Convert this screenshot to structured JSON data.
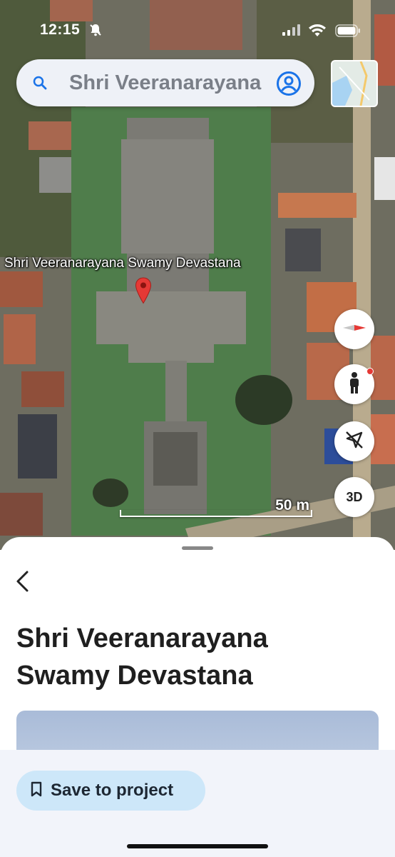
{
  "status_bar": {
    "time": "12:15"
  },
  "search": {
    "query": "Shri Veeranarayana Swamy Devastana"
  },
  "map": {
    "place_label": "Shri Veeranarayana Swamy Devastana",
    "scale_label": "50 m",
    "controls": {
      "three_d_label": "3D"
    }
  },
  "sheet": {
    "title_line1": "Shri Veeranarayana",
    "title_line2": "Swamy Devastana",
    "save_button_label": "Save to project"
  },
  "colors": {
    "accent": "#1a73e8",
    "pin": "#e53935",
    "save_button_bg": "#cde7f9"
  },
  "icons": [
    "search-icon",
    "account-icon",
    "map-layers-thumbnail",
    "compass-icon",
    "pegman-icon",
    "location-off-icon",
    "back-arrow-icon",
    "bookmark-icon",
    "do-not-disturb-bell-icon",
    "signal-icon",
    "wifi-icon",
    "battery-icon"
  ]
}
